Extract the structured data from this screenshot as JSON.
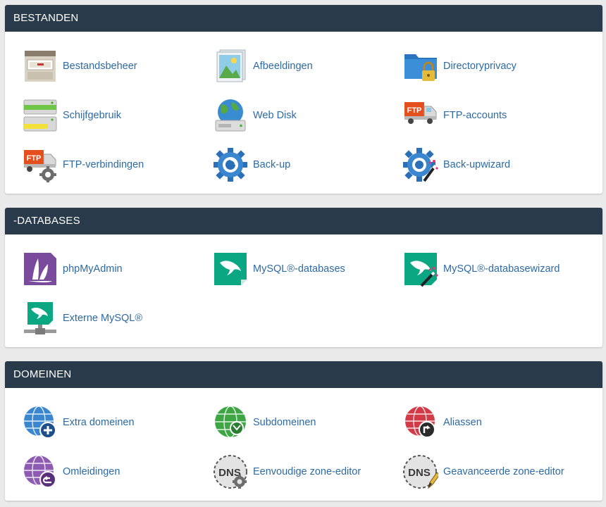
{
  "sections": [
    {
      "title": "BESTANDEN",
      "items": [
        {
          "label": "Bestandsbeheer",
          "icon": "file-cabinet-icon"
        },
        {
          "label": "Afbeeldingen",
          "icon": "images-icon"
        },
        {
          "label": "Directoryprivacy",
          "icon": "folder-lock-icon"
        },
        {
          "label": "Schijfgebruik",
          "icon": "disk-usage-icon"
        },
        {
          "label": "Web Disk",
          "icon": "web-disk-icon"
        },
        {
          "label": "FTP-accounts",
          "icon": "ftp-truck-icon"
        },
        {
          "label": "FTP-verbindingen",
          "icon": "ftp-connections-icon"
        },
        {
          "label": "Back-up",
          "icon": "backup-icon"
        },
        {
          "label": "Back-upwizard",
          "icon": "backup-wizard-icon"
        }
      ]
    },
    {
      "title": "-DATABASES",
      "items": [
        {
          "label": "phpMyAdmin",
          "icon": "phpmyadmin-icon"
        },
        {
          "label": "MySQL®-databases",
          "icon": "mysql-databases-icon"
        },
        {
          "label": "MySQL®-databasewizard",
          "icon": "mysql-wizard-icon"
        },
        {
          "label": "Externe MySQL®",
          "icon": "remote-mysql-icon"
        }
      ]
    },
    {
      "title": "DOMEINEN",
      "items": [
        {
          "label": "Extra domeinen",
          "icon": "addon-domains-icon"
        },
        {
          "label": "Subdomeinen",
          "icon": "subdomains-icon"
        },
        {
          "label": "Aliassen",
          "icon": "aliases-icon"
        },
        {
          "label": "Omleidingen",
          "icon": "redirects-icon"
        },
        {
          "label": "Eenvoudige zone-editor",
          "icon": "simple-zone-editor-icon"
        },
        {
          "label": "Geavanceerde zone-editor",
          "icon": "advanced-zone-editor-icon"
        }
      ]
    }
  ],
  "colors": {
    "header_bg": "#293a4a",
    "link": "#2d6aa3",
    "page_bg": "#eaeaea"
  }
}
